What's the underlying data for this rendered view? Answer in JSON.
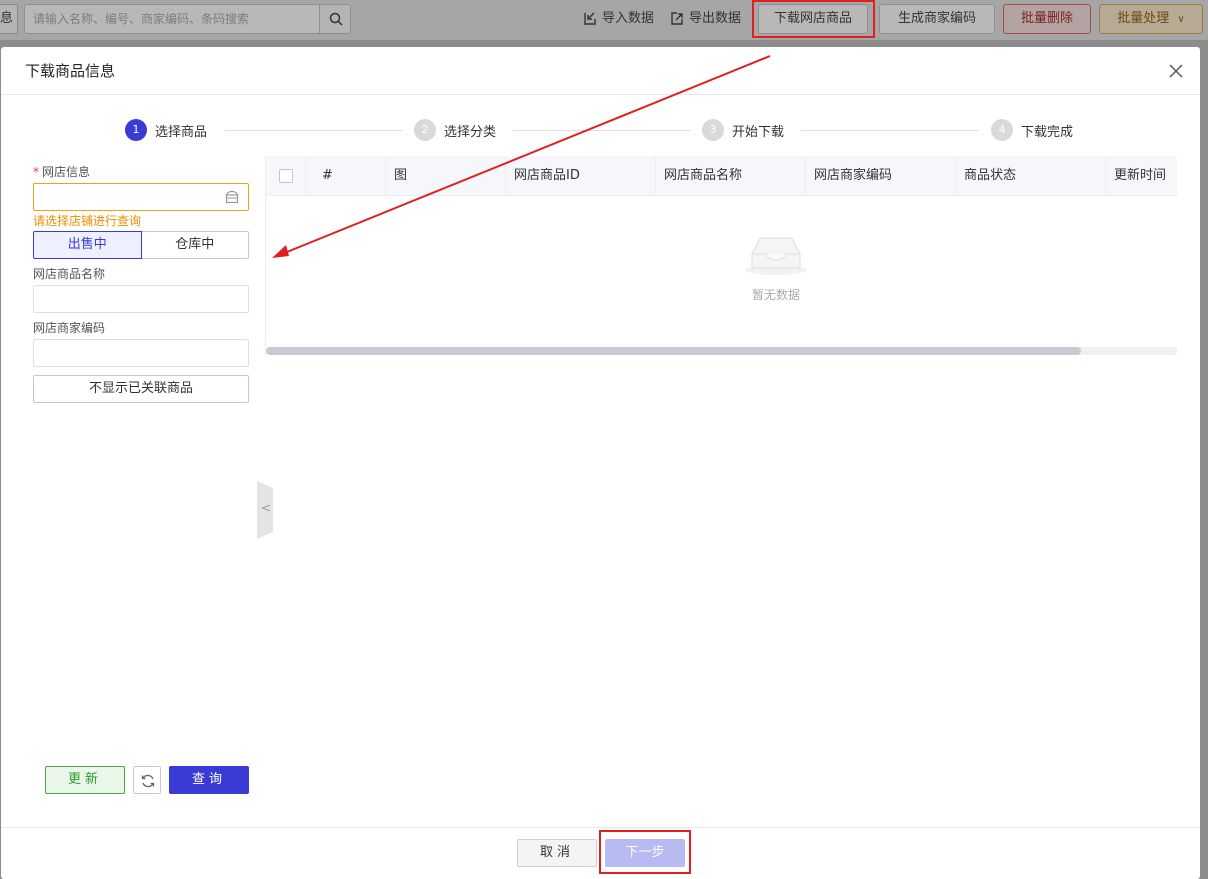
{
  "background": {
    "stub_label": "息",
    "search_placeholder": "请输入名称、编号、商家编码、条码搜索",
    "import_label": "导入数据",
    "export_label": "导出数据",
    "download_label": "下载网店商品",
    "generate_label": "生成商家编码",
    "delete_label": "批量删除",
    "batch_label": "批量处理"
  },
  "modal": {
    "title": "下载商品信息",
    "steps": [
      {
        "num": "1",
        "label": "选择商品",
        "active": true
      },
      {
        "num": "2",
        "label": "选择分类",
        "active": false
      },
      {
        "num": "3",
        "label": "开始下载",
        "active": false
      },
      {
        "num": "4",
        "label": "下载完成",
        "active": false
      }
    ],
    "form": {
      "shop_label": "网店信息",
      "shop_required_mark": "*",
      "shop_hint": "请选择店铺进行查询",
      "status_on_sale": "出售中",
      "status_in_stock": "仓库中",
      "name_label": "网店商品名称",
      "code_label": "网店商家编码",
      "hide_linked_label": "不显示已关联商品"
    },
    "actions": {
      "update_label": "更新",
      "query_label": "查询"
    },
    "table": {
      "columns": [
        "#",
        "图",
        "网店商品ID",
        "网店商品名称",
        "网店商家编码",
        "商品状态",
        "更新时间"
      ],
      "empty_text": "暂无数据"
    },
    "footer": {
      "cancel_label": "取消",
      "next_label": "下一步"
    }
  },
  "colors": {
    "primary": "#3a3ad4",
    "annotation": "#e02020",
    "warning": "#f08c00",
    "success": "#2e9d2e"
  }
}
